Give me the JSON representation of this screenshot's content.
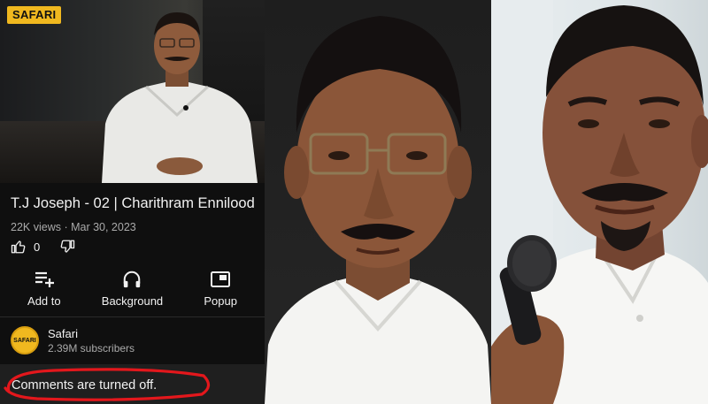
{
  "thumbnail": {
    "logo": "SAFARI"
  },
  "video": {
    "title": "T.J Joseph - 02 | Charithram Ennilood",
    "meta": "22K views · Mar 30, 2023",
    "like_count": "0"
  },
  "actions": [
    {
      "label": "Add to",
      "icon": "playlist-add-icon"
    },
    {
      "label": "Background",
      "icon": "headphones-icon"
    },
    {
      "label": "Popup",
      "icon": "picture-in-picture-icon"
    }
  ],
  "channel": {
    "name": "Safari",
    "subscribers": "2.39M subscribers",
    "avatar_text": "SAFARI"
  },
  "comments": {
    "status": "Comments are turned off."
  },
  "colors": {
    "background": "#0f0f0f",
    "text": "#f1f1f1",
    "secondary_text": "#aaaaaa",
    "brand": "#f0b81f",
    "annotation": "#e3171c"
  }
}
